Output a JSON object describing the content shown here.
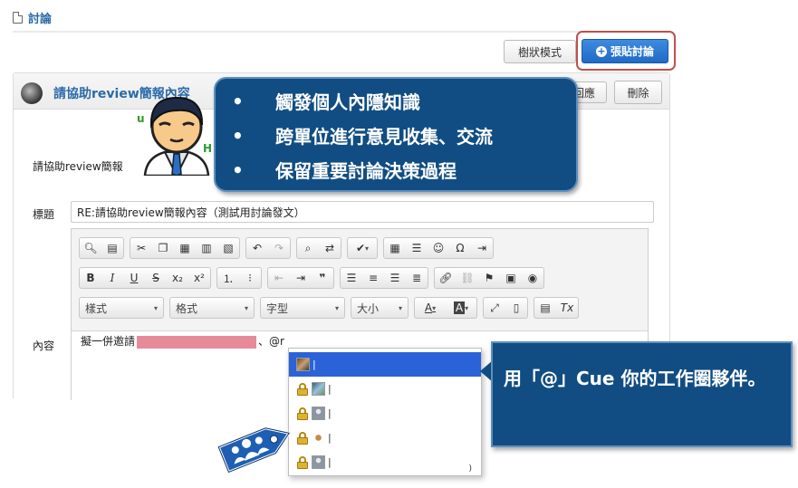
{
  "page": {
    "title": "討論"
  },
  "actions": {
    "tree_mode": "樹狀模式",
    "post_discussion": "張貼討論",
    "post_icon": "plus-circle-icon"
  },
  "post": {
    "title": "請協助review簡報內容",
    "reply_label": "回應",
    "delete_label": "刪除",
    "green_fragment_1": "u",
    "green_fragment_2": "H",
    "request_label": "請協助review簡報"
  },
  "form": {
    "subject_label": "標題",
    "subject_value": "RE:請協助review簡報內容（測試用討論發文）",
    "content_label": "內容",
    "body_text_prefix": "擬一併邀請",
    "body_text_suffix": "、@r"
  },
  "toolbar": {
    "style_label": "樣式",
    "format_label": "格式",
    "font_label": "字型",
    "size_label": "大小",
    "bold": "B",
    "italic": "I",
    "underline": "U",
    "strike": "S",
    "subscript": "x₂",
    "superscript": "x²",
    "quote": "❞",
    "font_color": "A",
    "bg_color": "A",
    "omega": "Ω",
    "clear_format": "Tx"
  },
  "mention_dropdown": {
    "rows": [
      {
        "avatar": "photo-avatar",
        "locked": false,
        "text": "|"
      },
      {
        "avatar": "scene-avatar",
        "locked": true,
        "text": "|"
      },
      {
        "avatar": "person-avatar",
        "locked": true,
        "text": "|"
      },
      {
        "avatar": "owl-avatar",
        "locked": true,
        "text": "|"
      },
      {
        "avatar": "person-avatar",
        "locked": true,
        "text": "|"
      }
    ],
    "trailing_mark": ")"
  },
  "callouts": {
    "bullets": [
      "觸發個人內隱知識",
      "跨單位進行意見收集、交流",
      "保留重要討論決策過程"
    ],
    "bullet_symbol": "•",
    "mention_tip": "用「@」Cue 你的工作圈夥伴。"
  },
  "colors": {
    "callout_bg": "#114d82",
    "primary_button": "#1f6bc5",
    "highlight_border": "#c0504d",
    "link_blue": "#2a6aa8"
  }
}
